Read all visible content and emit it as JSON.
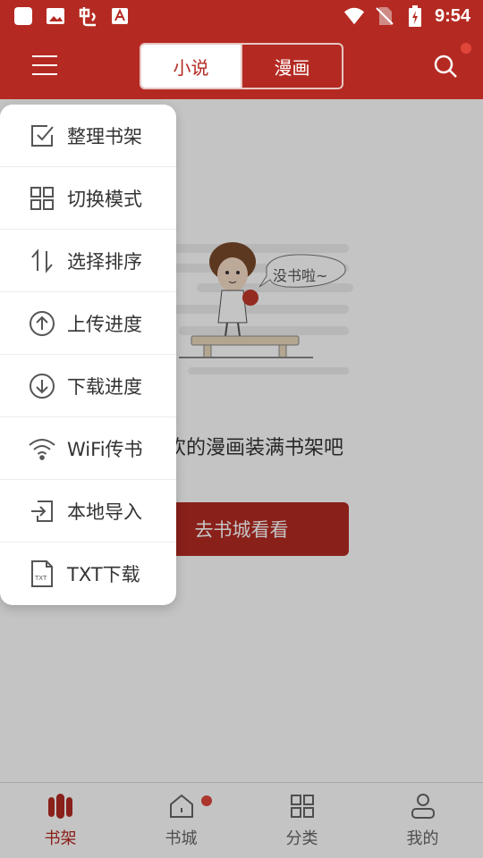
{
  "status_bar": {
    "time": "9:54"
  },
  "header": {
    "tabs": [
      {
        "label": "小说",
        "active": true
      },
      {
        "label": "漫画",
        "active": false
      }
    ]
  },
  "empty_state": {
    "illustration_caption": "没书啦~",
    "message": "欢的漫画装满书架吧",
    "button_label": "去书城看看"
  },
  "popup_menu": {
    "items": [
      {
        "label": "整理书架",
        "icon": "checkbox-edit-icon"
      },
      {
        "label": "切换模式",
        "icon": "grid-icon"
      },
      {
        "label": "选择排序",
        "icon": "sort-arrows-icon"
      },
      {
        "label": "上传进度",
        "icon": "upload-circle-icon"
      },
      {
        "label": "下载进度",
        "icon": "download-circle-icon"
      },
      {
        "label": "WiFi传书",
        "icon": "wifi-icon"
      },
      {
        "label": "本地导入",
        "icon": "import-icon"
      },
      {
        "label": "TXT下载",
        "icon": "txt-file-icon"
      }
    ]
  },
  "bottom_nav": {
    "items": [
      {
        "label": "书架",
        "icon": "bookshelf-icon",
        "active": true
      },
      {
        "label": "书城",
        "icon": "home-icon",
        "active": false,
        "badge_dot": true
      },
      {
        "label": "分类",
        "icon": "category-grid-icon",
        "active": false
      },
      {
        "label": "我的",
        "icon": "user-icon",
        "active": false
      }
    ]
  },
  "colors": {
    "primary": "#b42a22",
    "badge": "#e0453a",
    "overlay": "rgba(0,0,0,0.23)"
  }
}
